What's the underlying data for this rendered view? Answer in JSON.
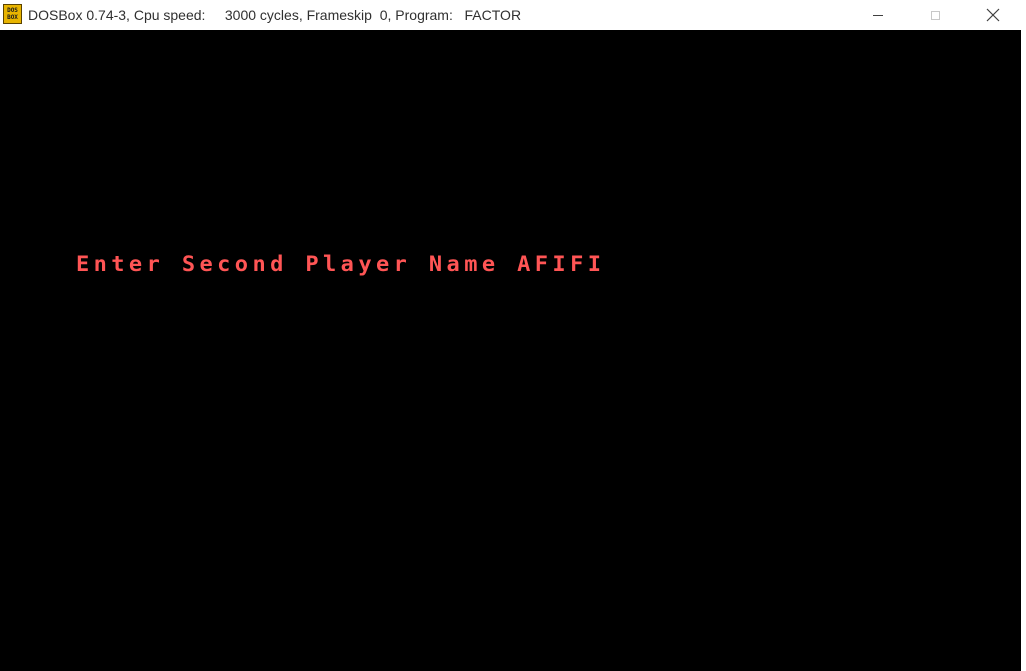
{
  "window": {
    "title": "DOSBox 0.74-3, Cpu speed:     3000 cycles, Frameskip  0, Program:   FACTOR",
    "icon": "dosbox-app-icon",
    "icon_text_top": "DOS",
    "icon_text_bottom": "BOX",
    "controls": {
      "minimize": "minimize-icon",
      "maximize": "maximize-icon",
      "close": "close-icon"
    }
  },
  "screen": {
    "background": "#000000",
    "prompt_text": "Enter Second Player Name AFIFI",
    "prompt_color": "#ff5555"
  }
}
